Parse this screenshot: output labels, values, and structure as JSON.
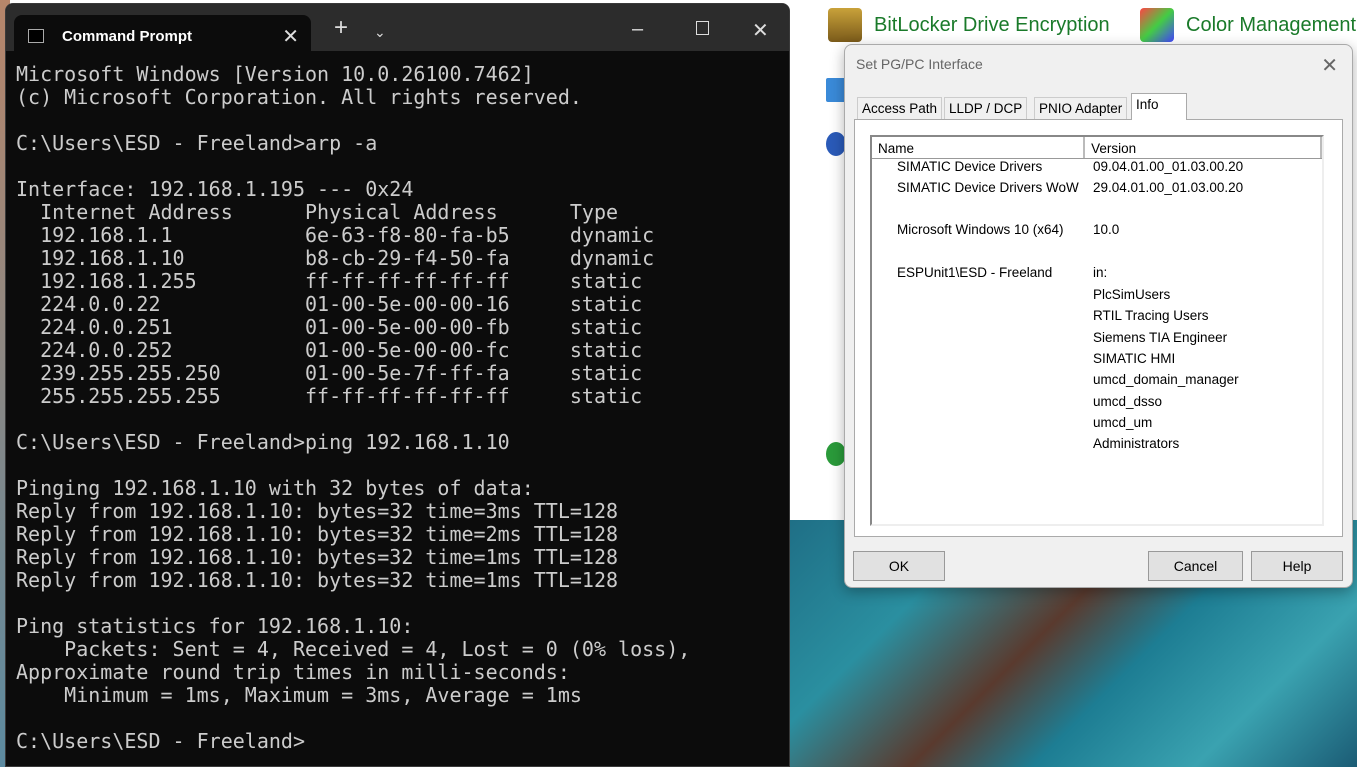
{
  "desktop": {
    "control_panel_items": [
      "BitLocker Drive Encryption",
      "Color Management"
    ]
  },
  "terminal": {
    "tab_title": "Command Prompt",
    "lines": [
      "Microsoft Windows [Version 10.0.26100.7462]",
      "(c) Microsoft Corporation. All rights reserved.",
      "",
      "C:\\Users\\ESD - Freeland>arp -a",
      "",
      "Interface: 192.168.1.195 --- 0x24",
      "  Internet Address      Physical Address      Type",
      "  192.168.1.1           6e-63-f8-80-fa-b5     dynamic",
      "  192.168.1.10          b8-cb-29-f4-50-fa     dynamic",
      "  192.168.1.255         ff-ff-ff-ff-ff-ff     static",
      "  224.0.0.22            01-00-5e-00-00-16     static",
      "  224.0.0.251           01-00-5e-00-00-fb     static",
      "  224.0.0.252           01-00-5e-00-00-fc     static",
      "  239.255.255.250       01-00-5e-7f-ff-fa     static",
      "  255.255.255.255       ff-ff-ff-ff-ff-ff     static",
      "",
      "C:\\Users\\ESD - Freeland>ping 192.168.1.10",
      "",
      "Pinging 192.168.1.10 with 32 bytes of data:",
      "Reply from 192.168.1.10: bytes=32 time=3ms TTL=128",
      "Reply from 192.168.1.10: bytes=32 time=2ms TTL=128",
      "Reply from 192.168.1.10: bytes=32 time=1ms TTL=128",
      "Reply from 192.168.1.10: bytes=32 time=1ms TTL=128",
      "",
      "Ping statistics for 192.168.1.10:",
      "    Packets: Sent = 4, Received = 4, Lost = 0 (0% loss),",
      "Approximate round trip times in milli-seconds:",
      "    Minimum = 1ms, Maximum = 3ms, Average = 1ms",
      "",
      "C:\\Users\\ESD - Freeland>"
    ]
  },
  "dialog": {
    "title": "Set PG/PC Interface",
    "tabs": [
      "Access Path",
      "LLDP / DCP",
      "PNIO Adapter",
      "Info"
    ],
    "active_tab": "Info",
    "columns": [
      "Name",
      "Version"
    ],
    "rows": [
      {
        "name": "SIMATIC Device Drivers",
        "version": "09.04.01.00_01.03.00.20"
      },
      {
        "name": "SIMATIC Device Drivers WoW",
        "version": "29.04.01.00_01.03.00.20"
      },
      {
        "name": "Microsoft Windows 10 (x64)",
        "version": "10.0"
      },
      {
        "name": "ESPUnit1\\ESD - Freeland",
        "version": "in:"
      }
    ],
    "groups": [
      "PlcSimUsers",
      "RTIL Tracing Users",
      "Siemens TIA Engineer",
      "SIMATIC HMI",
      "umcd_domain_manager",
      "umcd_dsso",
      "umcd_um",
      "Administrators"
    ],
    "buttons": {
      "ok": "OK",
      "cancel": "Cancel",
      "help": "Help"
    }
  }
}
